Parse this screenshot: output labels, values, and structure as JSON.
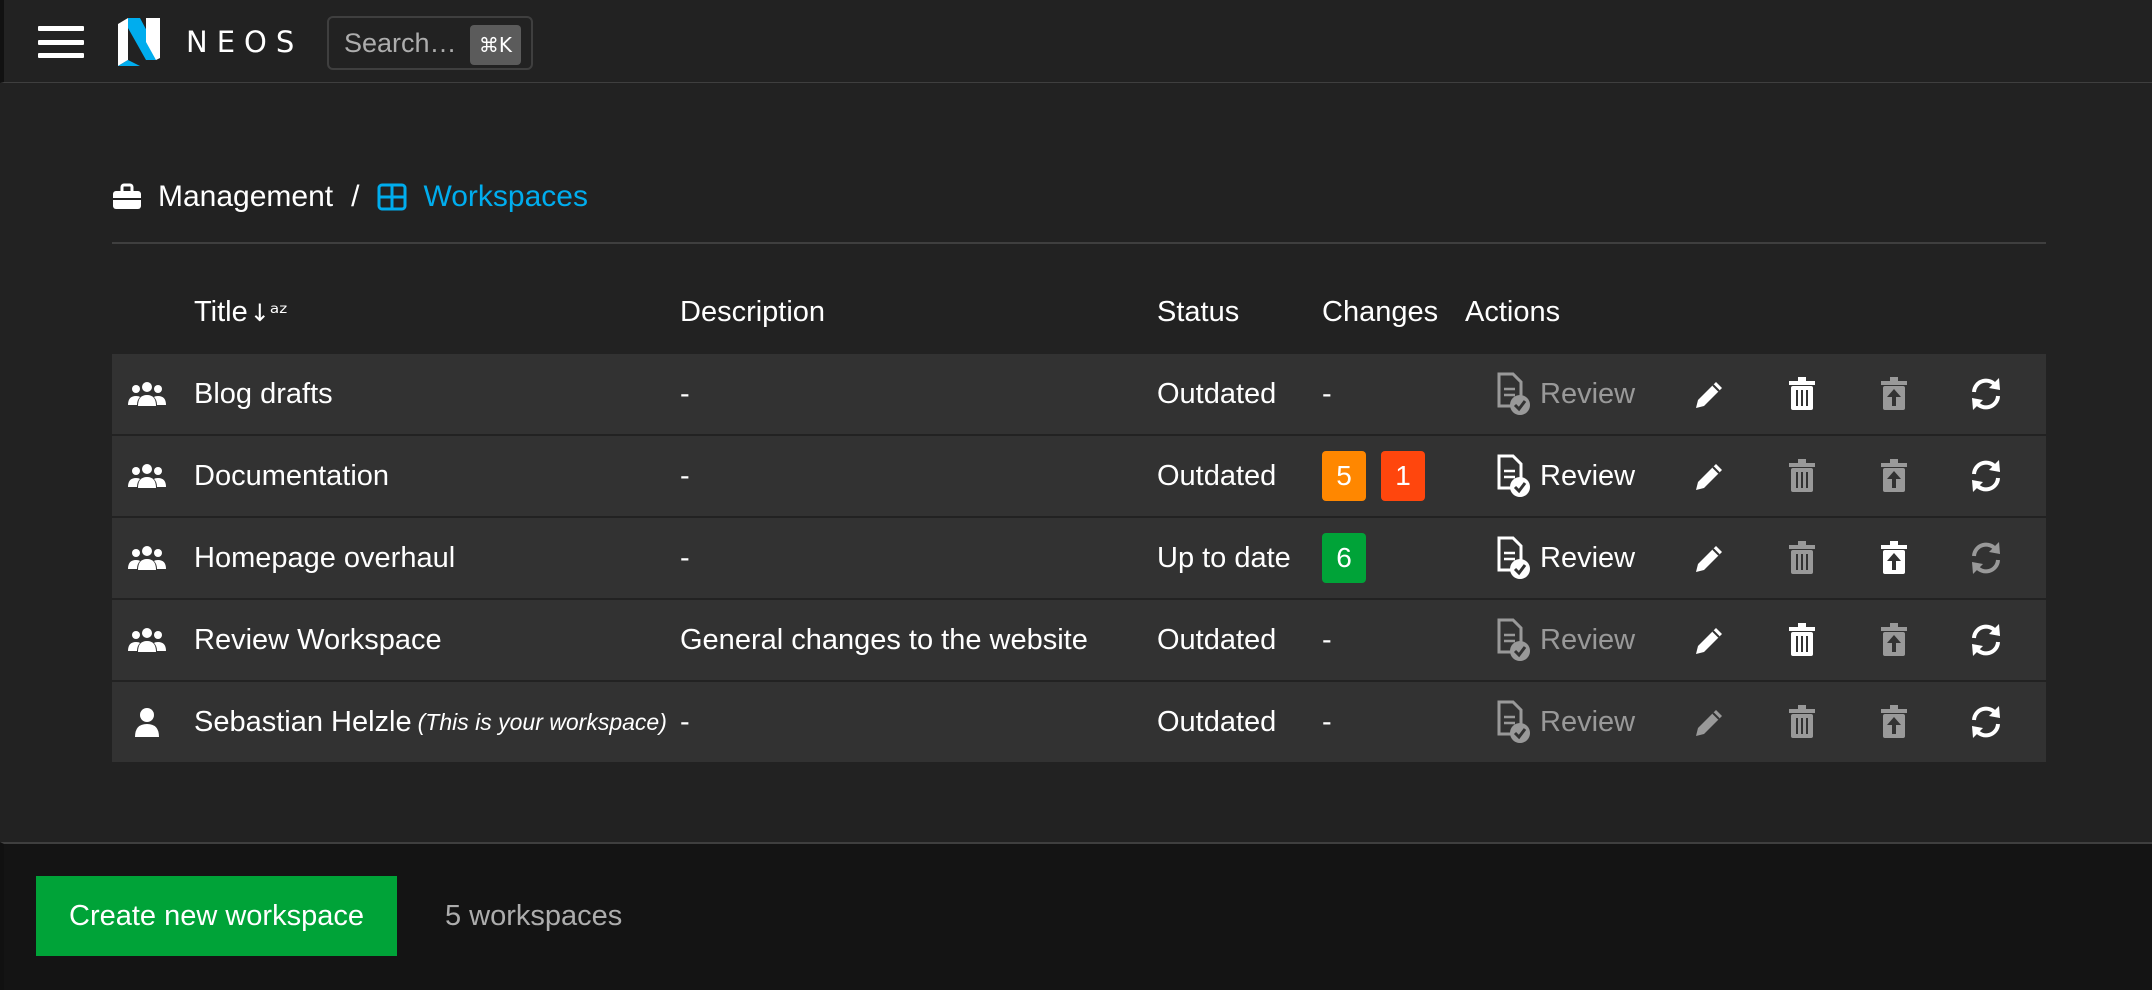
{
  "topbar": {
    "logo_text": "NEOS",
    "search_placeholder": "Search…",
    "search_shortcut": "⌘K"
  },
  "breadcrumb": {
    "parent": "Management",
    "separator": "/",
    "current": "Workspaces"
  },
  "table": {
    "headers": {
      "title": "Title",
      "description": "Description",
      "status": "Status",
      "changes": "Changes",
      "actions": "Actions"
    },
    "rows": [
      {
        "title": "Blog drafts",
        "title_note": "",
        "description": "-",
        "status": "Outdated",
        "changes_text": "-",
        "review": "Review",
        "icon": "users-icon"
      },
      {
        "title": "Documentation",
        "title_note": "",
        "description": "-",
        "status": "Outdated",
        "changes_text": "",
        "badges": [
          "5",
          "1"
        ],
        "review": "Review",
        "icon": "users-icon"
      },
      {
        "title": "Homepage overhaul",
        "title_note": "",
        "description": "-",
        "status": "Up to date",
        "changes_text": "",
        "badges": [
          "6"
        ],
        "review": "Review",
        "icon": "users-icon"
      },
      {
        "title": "Review Workspace",
        "title_note": "",
        "description": "General changes to the website",
        "status": "Outdated",
        "changes_text": "-",
        "review": "Review",
        "icon": "users-icon"
      },
      {
        "title": "Sebastian Helzle",
        "title_note": "(This is your workspace)",
        "description": "-",
        "status": "Outdated",
        "changes_text": "-",
        "review": "Review",
        "icon": "user-icon"
      }
    ]
  },
  "footer": {
    "create_label": "Create new workspace",
    "count_text": "5 workspaces"
  },
  "colors": {
    "accent_blue": "#00adee",
    "green": "#00a338",
    "orange": "#ff8700",
    "red": "#ff460d"
  }
}
